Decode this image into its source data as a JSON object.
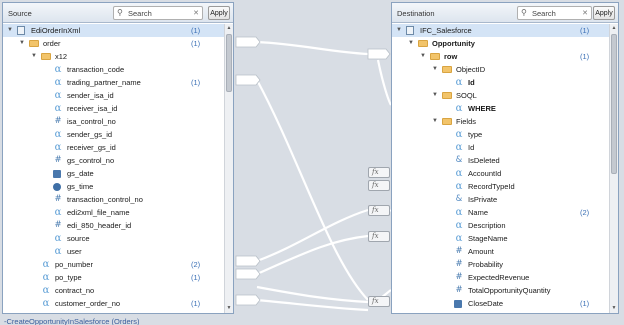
{
  "source": {
    "title": "Source",
    "search_placeholder": "Search",
    "apply_label": "Apply",
    "rows": [
      {
        "label": "EdiOrderInXml",
        "icon": "document-icon",
        "count": "(1)",
        "expanded": true
      },
      {
        "label": "order",
        "icon": "folder-icon",
        "count": "(1)",
        "expanded": true
      },
      {
        "label": "x12",
        "icon": "folder-icon",
        "count": "",
        "expanded": true
      },
      {
        "label": "transaction_code",
        "icon": "alpha-icon",
        "count": ""
      },
      {
        "label": "trading_partner_name",
        "icon": "alpha-icon",
        "count": "(1)"
      },
      {
        "label": "sender_isa_id",
        "icon": "alpha-icon",
        "count": ""
      },
      {
        "label": "receiver_isa_id",
        "icon": "alpha-icon",
        "count": ""
      },
      {
        "label": "isa_control_no",
        "icon": "hash-icon",
        "count": ""
      },
      {
        "label": "sender_gs_id",
        "icon": "alpha-icon",
        "count": ""
      },
      {
        "label": "receiver_gs_id",
        "icon": "alpha-icon",
        "count": ""
      },
      {
        "label": "gs_control_no",
        "icon": "hash-icon",
        "count": ""
      },
      {
        "label": "gs_date",
        "icon": "date-icon",
        "count": ""
      },
      {
        "label": "gs_time",
        "icon": "clock-icon",
        "count": ""
      },
      {
        "label": "transaction_control_no",
        "icon": "hash-icon",
        "count": ""
      },
      {
        "label": "edi2xml_file_name",
        "icon": "alpha-icon",
        "count": ""
      },
      {
        "label": "edi_850_header_id",
        "icon": "hash-icon",
        "count": ""
      },
      {
        "label": "source",
        "icon": "alpha-icon",
        "count": ""
      },
      {
        "label": "user",
        "icon": "alpha-icon",
        "count": ""
      },
      {
        "label": "po_number",
        "icon": "alpha-icon",
        "count": "(2)"
      },
      {
        "label": "po_type",
        "icon": "alpha-icon",
        "count": "(1)"
      },
      {
        "label": "contract_no",
        "icon": "alpha-icon",
        "count": ""
      },
      {
        "label": "customer_order_no",
        "icon": "alpha-icon",
        "count": "(1)"
      }
    ]
  },
  "destination": {
    "title": "Destination",
    "search_placeholder": "Search",
    "apply_label": "Apply",
    "rows": [
      {
        "label": "IFC_Salesforce",
        "icon": "document-icon",
        "count": "(1)",
        "expanded": true,
        "bold": false
      },
      {
        "label": "Opportunity",
        "icon": "folder-icon",
        "count": "",
        "expanded": true,
        "bold": true
      },
      {
        "label": "row",
        "icon": "folder-icon",
        "count": "(1)",
        "expanded": true,
        "bold": true
      },
      {
        "label": "ObjectID",
        "icon": "folder-icon",
        "count": "",
        "expanded": true,
        "bold": false
      },
      {
        "label": "Id",
        "icon": "alpha-icon",
        "count": "",
        "bold": true
      },
      {
        "label": "SOQL",
        "icon": "folder-icon",
        "count": "",
        "expanded": true,
        "bold": false
      },
      {
        "label": "WHERE",
        "icon": "alpha-icon",
        "count": "",
        "bold": true
      },
      {
        "label": "Fields",
        "icon": "folder-icon",
        "count": "",
        "expanded": true,
        "bold": false
      },
      {
        "label": "type",
        "icon": "alpha-icon",
        "count": ""
      },
      {
        "label": "Id",
        "icon": "alpha-icon",
        "count": ""
      },
      {
        "label": "IsDeleted",
        "icon": "boolean-icon",
        "count": ""
      },
      {
        "label": "AccountId",
        "icon": "alpha-icon",
        "count": ""
      },
      {
        "label": "RecordTypeId",
        "icon": "alpha-icon",
        "count": ""
      },
      {
        "label": "IsPrivate",
        "icon": "boolean-icon",
        "count": ""
      },
      {
        "label": "Name",
        "icon": "alpha-icon",
        "count": "(2)"
      },
      {
        "label": "Description",
        "icon": "alpha-icon",
        "count": ""
      },
      {
        "label": "StageName",
        "icon": "alpha-icon",
        "count": ""
      },
      {
        "label": "Amount",
        "icon": "hash-icon",
        "count": ""
      },
      {
        "label": "Probability",
        "icon": "hash-icon",
        "count": ""
      },
      {
        "label": "ExpectedRevenue",
        "icon": "hash-icon",
        "count": ""
      },
      {
        "label": "TotalOpportunityQuantity",
        "icon": "hash-icon",
        "count": ""
      },
      {
        "label": "CloseDate",
        "icon": "date-icon",
        "count": "(1)"
      }
    ]
  },
  "function_label": "fx",
  "footer_link": "-CreateOpportunityInSalesforce (Orders)",
  "colors": {
    "accent": "#3a6fb5",
    "selection": "#d4e4f6",
    "panel_border": "#8aa2bf"
  }
}
